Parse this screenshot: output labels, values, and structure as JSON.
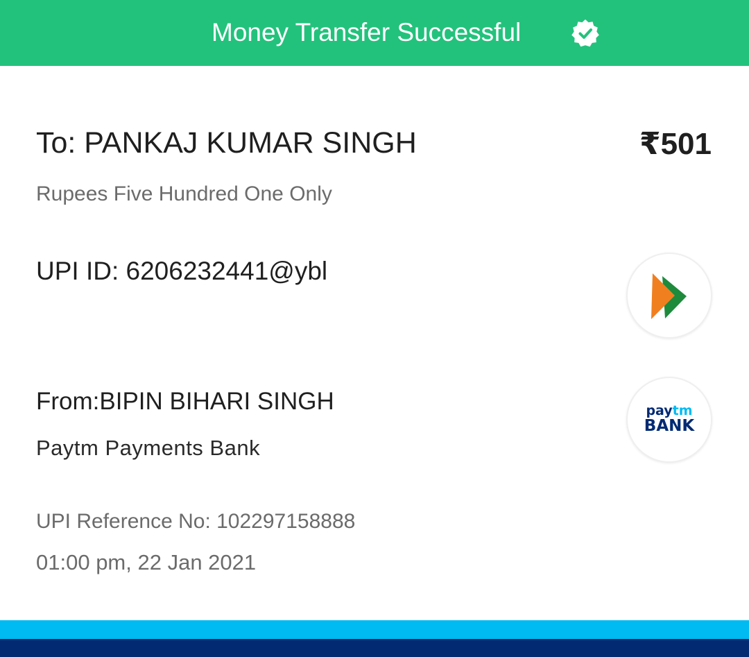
{
  "header": {
    "title": "Money Transfer Successful",
    "icon": "verified-check-icon",
    "bg_color": "#23c27c"
  },
  "payee": {
    "to_label": "To: PANKAJ KUMAR SINGH",
    "amount": "₹501",
    "amount_words": "Rupees Five Hundred One Only",
    "upi_id": "UPI ID: 6206232441@ybl",
    "logo_icon": "upi-logo-icon"
  },
  "payer": {
    "from_label": "From:BIPIN BIHARI SINGH",
    "bank": "Paytm Payments Bank",
    "logo": {
      "icon": "paytm-bank-logo-icon",
      "line1_a": "pay",
      "line1_b": "tm",
      "line2": "BANK"
    }
  },
  "transaction": {
    "reference": "UPI Reference No: 102297158888",
    "timestamp": "01:00 pm, 22 Jan 2021"
  },
  "footer": {
    "stripe_light_color": "#00baf2",
    "stripe_dark_color": "#012a72"
  }
}
